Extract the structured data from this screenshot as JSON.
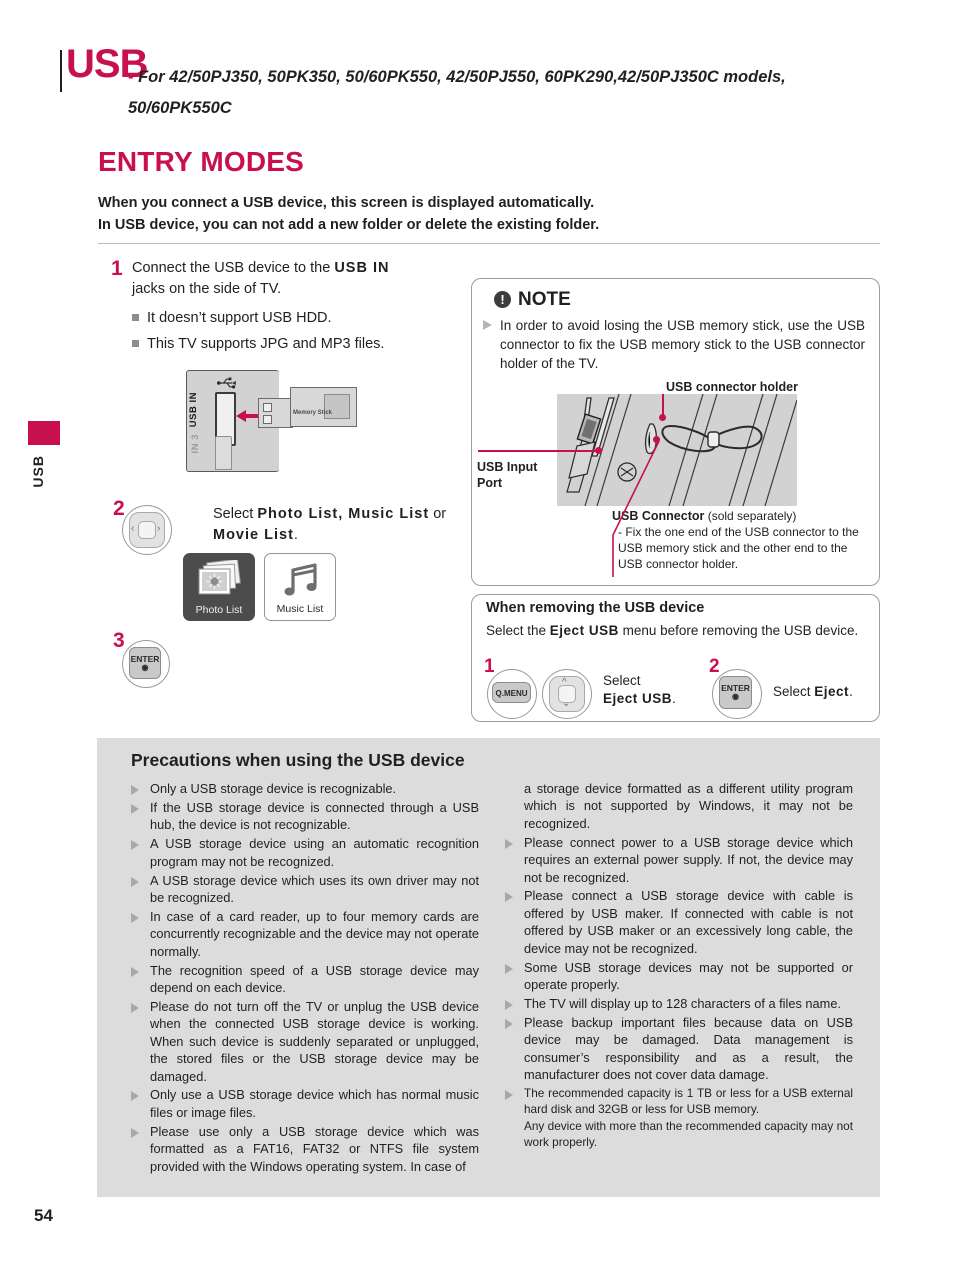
{
  "page": {
    "number": "54",
    "side_label": "USB",
    "accent_color": "#c8104e"
  },
  "header": {
    "title": "USB",
    "dash": "-",
    "models_line1": "For  42/50PJ350, 50PK350, 50/60PK550, 42/50PJ550, 60PK290,42/50PJ350C models,",
    "models_line2": "50/60PK550C",
    "section_title": "ENTRY MODES",
    "intro_line1": "When you connect a USB device, this screen is displayed automatically.",
    "intro_line2": "In USB device, you can not add a new folder or delete the existing folder."
  },
  "steps": {
    "step1": {
      "num": "1",
      "text_a": "Connect the USB device to the ",
      "text_bold": "USB IN",
      "text_b": "jacks on the side of TV.",
      "bullets": [
        "It doesn’t support USB HDD.",
        "This TV supports JPG and MP3 files."
      ]
    },
    "step2": {
      "num": "2",
      "text_a": "Select ",
      "text_bold1": "Photo List, Music List",
      "text_mid": " or ",
      "text_bold2": "Movie List",
      "text_end": ".",
      "tiles": [
        {
          "label": "Photo List",
          "icon": "photo-stack-icon"
        },
        {
          "label": "Music List",
          "icon": "music-note-icon"
        }
      ]
    },
    "step3": {
      "num": "3",
      "key_label": "ENTER"
    }
  },
  "jack_diagram": {
    "usb_in_label": "USB IN",
    "secondary_label": "IN 3",
    "memory_stick_label": "Memory Stick",
    "usb_symbol_icon": "usb-trident-icon"
  },
  "note_panel": {
    "icon": "exclamation-icon",
    "title": "NOTE",
    "body": "In order to avoid losing the USB memory stick, use the USB connector to fix the USB memory stick to the USB connector holder of the TV.",
    "label_holder": "USB connector holder",
    "label_input_line1": "USB Input",
    "label_input_line2": "Port",
    "label_connector_title": "USB Connector",
    "label_connector_note": " (sold separately)",
    "label_connector_body": "- Fix the one end of the USB connector to the USB memory stick and the other end to the USB connector holder."
  },
  "removing_panel": {
    "title": "When removing the USB device",
    "sub_a": "Select the ",
    "sub_bold": "Eject USB",
    "sub_b": " menu before removing the USB device.",
    "step1_num": "1",
    "step1_key": "Q.MENU",
    "step1_text_a": "Select",
    "step1_text_bold": "Eject USB",
    "step1_text_end": ".",
    "step2_num": "2",
    "step2_key": "ENTER",
    "step2_text_a": "Select ",
    "step2_text_bold": "Eject",
    "step2_text_end": "."
  },
  "precautions": {
    "title": "Precautions when using the USB device",
    "left_items": [
      "Only a USB storage device is recognizable.",
      "If the USB storage device is connected through a USB hub, the device is not recognizable.",
      "A USB storage device using an automatic recognition program may not be recognized.",
      "A USB storage device which uses its own driver may not be recognized.",
      "In case of a card reader, up to four memory cards are concurrently recognizable and the device may not operate normally.",
      "The recognition speed of a USB storage device may depend on each device.",
      "Please do not turn off the TV or unplug the USB device when the connected USB storage device is working.  When such device is suddenly separated or unplugged, the stored files or the USB storage device may be damaged.",
      " Only use a USB storage device which has normal  music files or image files.",
      "Please use only a USB storage device which was formatted as a FAT16, FAT32 or NTFS file system provided with the Windows operating system.  In case of"
    ],
    "right_continuation": "a storage device formatted as a different utility program which is not supported by Windows, it may not be recognized.",
    "right_items": [
      "Please connect power to a USB storage device which requires an external power supply.  If not, the device may not be recognized.",
      "Please connect a USB storage device with cable is offered by USB maker.  If connected with cable is not offered by USB maker or an excessively long cable, the device may not be recognized.",
      "Some USB storage devices may not be supported or operate properly.",
      "The TV will display up to 128 characters of a files name.",
      "Please backup important files because data on USB device may be damaged. Data management is consumer’s responsibility and as a result, the manufacturer does not cover data damage.",
      "The recommended capacity is 1 TB or less for a USB external hard disk and 32GB or less for USB memory."
    ],
    "right_tail": "Any device with more than the recommended capacity may not work properly."
  }
}
